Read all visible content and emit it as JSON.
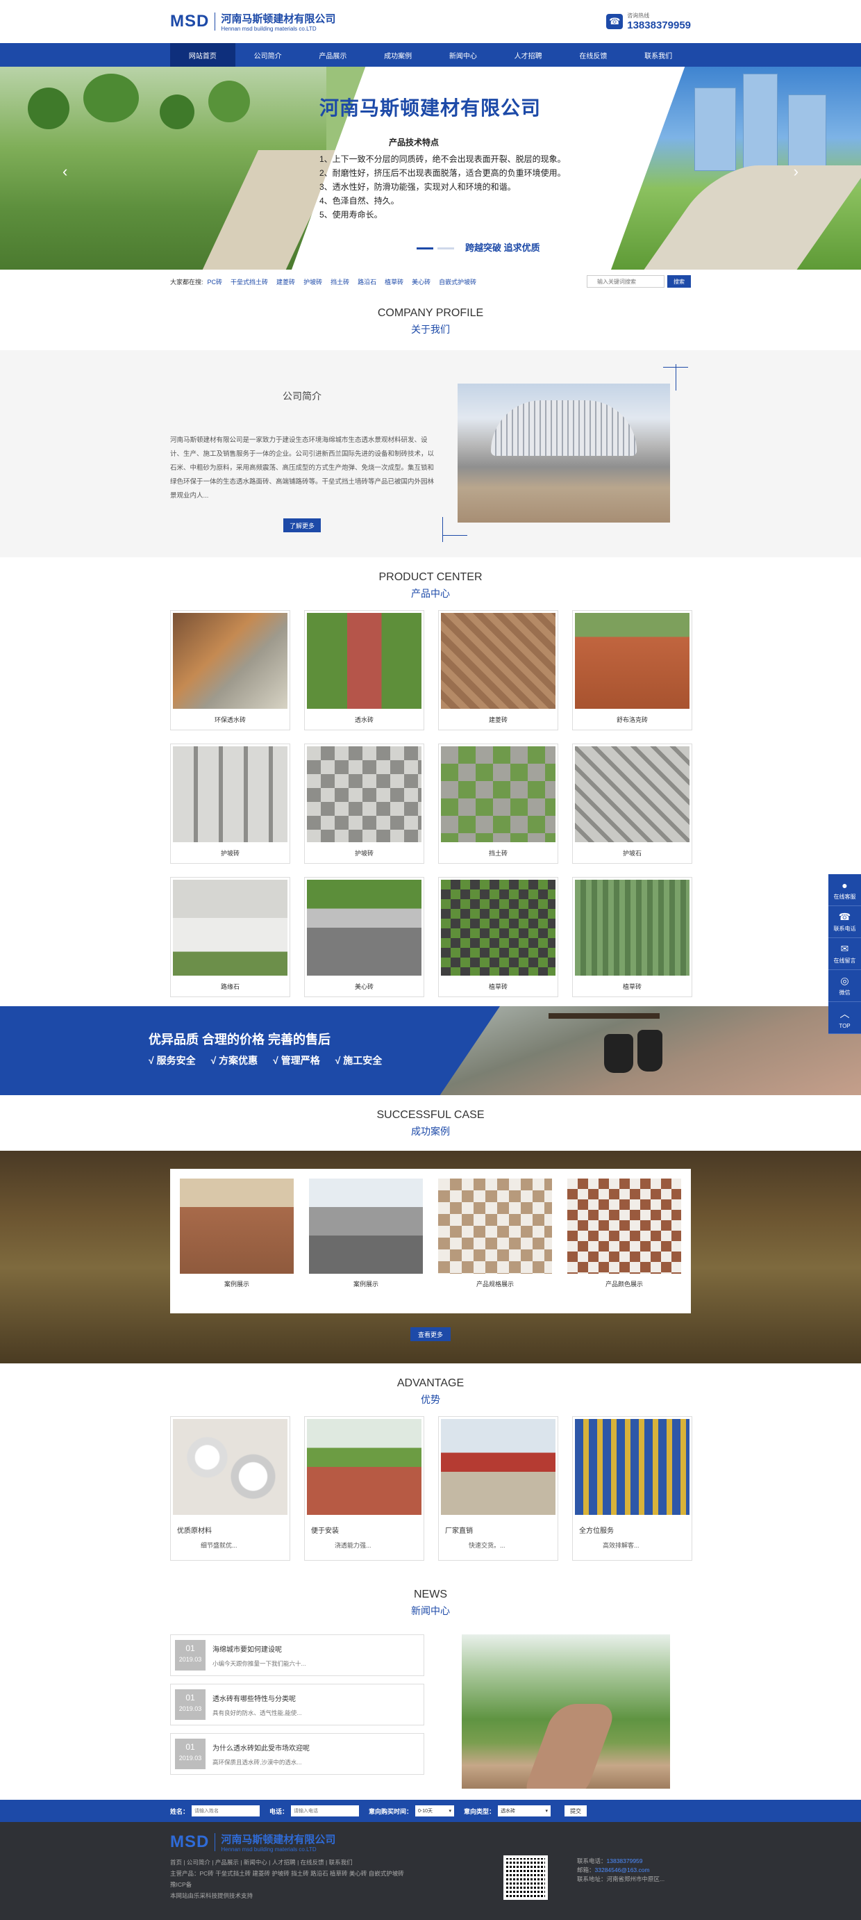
{
  "header": {
    "logo_mark": "MSD",
    "company_cn": "河南马斯顿建材有限公司",
    "company_en": "Hennan msd building materials co.LTD",
    "hotline_label": "咨询热线",
    "hotline_number": "13838379959"
  },
  "nav": {
    "items": [
      "网站首页",
      "公司简介",
      "产品展示",
      "成功案例",
      "新闻中心",
      "人才招聘",
      "在线反馈",
      "联系我们"
    ]
  },
  "banner": {
    "title": "河南马斯顿建材有限公司",
    "subtitle": "产品技术特点",
    "features": [
      "1、上下一致不分层的同质砖，绝不会出现表面开裂、脱层的现象。",
      "2、耐磨性好，挤压后不出现表面脱落，适合更高的负重环境使用。",
      "3、透水性好，防滑功能强，实现对人和环境的和谐。",
      "4、色泽自然、持久。",
      "5、使用寿命长。"
    ],
    "slogan": "跨越突破  追求优质",
    "prev": "‹",
    "next": "›"
  },
  "hotsearch": {
    "label": "大家都在搜:",
    "items": [
      "PC砖",
      "干垒式挡土砖",
      "建菱砖",
      "护坡砖",
      "挡土砖",
      "路沿石",
      "植草砖",
      "美心砖",
      "自嵌式护坡砖"
    ],
    "placeholder": "输入关键词搜索",
    "button": "搜索"
  },
  "about": {
    "en": "COMPANY PROFILE",
    "cn": "关于我们",
    "heading": "公司简介",
    "text": "河南马斯顿建材有限公司是一家致力于建设生态环境海绵城市生态透水景观材料研发、设计、生产、施工及销售服务于一体的企业。公司引进新西兰国际先进的设备和制砖技术，以石米、中粗砂为原料，采用高频震荡、高压成型的方式生产炮弹、免烧一次成型。集互锁和绿色环保于一体的生态透水路面砖、高端铺路砖等。干垒式挡土墙砖等产品已被国内外园林景观业内人...",
    "button": "了解更多"
  },
  "products": {
    "en": "PRODUCT CENTER",
    "cn": "产品中心",
    "items": [
      "环保透水砖",
      "透水砖",
      "建菱砖",
      "舒布洛克砖",
      "护坡砖",
      "护坡砖",
      "挡土砖",
      "护坡石",
      "路缘石",
      "美心砖",
      "植草砖",
      "植草砖"
    ]
  },
  "promo": {
    "main": "优异品质 合理的价格 完善的售后",
    "points": [
      "√ 服务安全",
      "√ 方案优惠",
      "√ 管理严格",
      "√ 施工安全"
    ]
  },
  "cases": {
    "en": "SUCCESSFUL CASE",
    "cn": "成功案例",
    "items": [
      "案例展示",
      "案例展示",
      "产品规格展示",
      "产品颜色展示"
    ],
    "more": "查看更多"
  },
  "advantage": {
    "en": "ADVANTAGE",
    "cn": "优势",
    "items": [
      {
        "title": "优质原材料",
        "desc": "细节盛就优..."
      },
      {
        "title": "便于安装",
        "desc": "浇透能力强..."
      },
      {
        "title": "厂家直销",
        "desc": "快速交货。..."
      },
      {
        "title": "全方位服务",
        "desc": "高效排解客..."
      }
    ]
  },
  "news": {
    "en": "NEWS",
    "cn": "新闻中心",
    "items": [
      {
        "day": "01",
        "ym": "2019.03",
        "title": "海绵城市要如何建设呢",
        "desc": "小编今天跟你推量一下我们能六十..."
      },
      {
        "day": "01",
        "ym": "2019.03",
        "title": "透水砖有哪些特性与分类呢",
        "desc": "具有良好的防水、透气性能,能使..."
      },
      {
        "day": "01",
        "ym": "2019.03",
        "title": "为什么透水砖如此受市场欢迎呢",
        "desc": "高环保质且透水砖,沙漠中的透水..."
      }
    ]
  },
  "message": {
    "name_label": "姓名：",
    "name_placeholder": "请输入姓名",
    "phone_label": "电话：",
    "phone_placeholder": "请输入电话",
    "time_label": "意向购买时间：",
    "time_value": "0-10天",
    "type_label": "意向类型：",
    "type_value": "透水砖",
    "submit": "提交"
  },
  "footer": {
    "logo_mark": "MSD",
    "company_cn": "河南马斯顿建材有限公司",
    "company_en": "Hennan msd building materials co.LTD",
    "links": "首页 | 公司简介 | 产品展示 | 新闻中心 | 人才招聘 | 在线反馈 | 联系我们",
    "products": "主营产品：PC砖 干垒式挡土砖 建菱砖 护坡砖 挡土砖 路沿石 植草砖 美心砖 自嵌式护坡砖",
    "icp": "豫ICP备",
    "support": "本网站由乐采科技提供技术支持",
    "phone_label": "联系电话：",
    "phone": "13838379959",
    "email_label": "邮箱：",
    "email": "33284546@163.com",
    "address_label": "联系地址：",
    "address": "河南省郑州市中原区..."
  },
  "side": {
    "items": [
      {
        "icon": "chat-icon",
        "label": "在线客服"
      },
      {
        "icon": "phone-icon",
        "label": "联系电话"
      },
      {
        "icon": "message-icon",
        "label": "在线留言"
      },
      {
        "icon": "wechat-icon",
        "label": "微信"
      },
      {
        "icon": "top-icon",
        "label": "TOP"
      }
    ]
  },
  "colors": {
    "primary": "#1d4aa8",
    "nav_active": "#0e2f7c",
    "footer_bg": "#2f3136"
  }
}
